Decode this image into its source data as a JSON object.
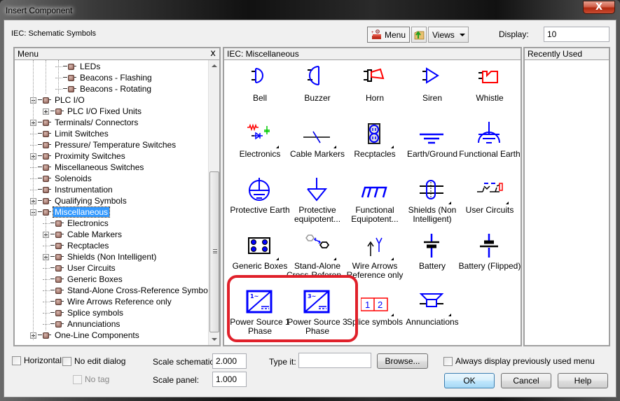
{
  "window": {
    "title": "Insert Component",
    "close_label": "X"
  },
  "header": {
    "library_label": "IEC: Schematic Symbols",
    "menu_button": "Menu",
    "views_button": "Views",
    "display_label": "Display:",
    "display_value": "10"
  },
  "menu_panel": {
    "title": "Menu",
    "close_label": "x",
    "items": [
      {
        "label": "LEDs",
        "level": 3,
        "expander": "none"
      },
      {
        "label": "Beacons - Flashing",
        "level": 3,
        "expander": "none"
      },
      {
        "label": "Beacons - Rotating",
        "level": 3,
        "expander": "none"
      },
      {
        "label": "PLC I/O",
        "level": 1,
        "expander": "minus"
      },
      {
        "label": "PLC I/O Fixed Units",
        "level": 2,
        "expander": "plus"
      },
      {
        "label": "Terminals/ Connectors",
        "level": 1,
        "expander": "plus"
      },
      {
        "label": "Limit Switches",
        "level": 1,
        "expander": "none"
      },
      {
        "label": "Pressure/ Temperature Switches",
        "level": 1,
        "expander": "none"
      },
      {
        "label": "Proximity Switches",
        "level": 1,
        "expander": "plus"
      },
      {
        "label": "Miscellaneous Switches",
        "level": 1,
        "expander": "none"
      },
      {
        "label": "Solenoids",
        "level": 1,
        "expander": "none"
      },
      {
        "label": "Instrumentation",
        "level": 1,
        "expander": "none"
      },
      {
        "label": "Qualifying Symbols",
        "level": 1,
        "expander": "plus"
      },
      {
        "label": "Miscellaneous",
        "level": 1,
        "expander": "minus",
        "selected": true
      },
      {
        "label": "Electronics",
        "level": 2,
        "expander": "none"
      },
      {
        "label": "Cable Markers",
        "level": 2,
        "expander": "plus"
      },
      {
        "label": "Recptacles",
        "level": 2,
        "expander": "none"
      },
      {
        "label": "Shields (Non Intelligent)",
        "level": 2,
        "expander": "plus"
      },
      {
        "label": "User Circuits",
        "level": 2,
        "expander": "none"
      },
      {
        "label": "Generic Boxes",
        "level": 2,
        "expander": "none"
      },
      {
        "label": "Stand-Alone Cross-Reference Symbols",
        "level": 2,
        "expander": "none"
      },
      {
        "label": "Wire Arrows Reference only",
        "level": 2,
        "expander": "none"
      },
      {
        "label": "Splice symbols",
        "level": 2,
        "expander": "none"
      },
      {
        "label": "Annunciations",
        "level": 2,
        "expander": "none"
      },
      {
        "label": "One-Line Components",
        "level": 1,
        "expander": "plus"
      }
    ]
  },
  "symbols_panel": {
    "title": "IEC: Miscellaneous",
    "symbols": [
      {
        "label": "Bell",
        "icon": "bell-icon",
        "submenu": false
      },
      {
        "label": "Buzzer",
        "icon": "buzzer-icon",
        "submenu": false
      },
      {
        "label": "Horn",
        "icon": "horn-icon",
        "submenu": false
      },
      {
        "label": "Siren",
        "icon": "siren-icon",
        "submenu": false
      },
      {
        "label": "Whistle",
        "icon": "whistle-icon",
        "submenu": false
      },
      {
        "label": "Electronics",
        "icon": "electronics-icon",
        "submenu": true
      },
      {
        "label": "Cable Markers",
        "icon": "cable-marker-icon",
        "submenu": true
      },
      {
        "label": "Recptacles",
        "icon": "receptacle-icon",
        "submenu": true
      },
      {
        "label": "Earth/Ground",
        "icon": "earth-ground-icon",
        "submenu": false
      },
      {
        "label": "Functional Earth",
        "icon": "functional-earth-icon",
        "submenu": false
      },
      {
        "label": "Protective Earth",
        "icon": "protective-earth-icon",
        "submenu": false
      },
      {
        "label": "Protective equipotent...",
        "icon": "protective-equipotential-icon",
        "submenu": false
      },
      {
        "label": "Functional Equipotent...",
        "icon": "functional-equipotential-icon",
        "submenu": false
      },
      {
        "label": "Shields (Non Intelligent)",
        "icon": "shield-icon",
        "submenu": true
      },
      {
        "label": "User Circuits",
        "icon": "user-circuit-icon",
        "submenu": true
      },
      {
        "label": "Generic Boxes",
        "icon": "generic-box-icon",
        "submenu": true
      },
      {
        "label": "Stand-Alone Cross-Referen...",
        "icon": "cross-reference-icon",
        "submenu": true
      },
      {
        "label": "Wire Arrows Reference only",
        "icon": "wire-arrow-icon",
        "submenu": true
      },
      {
        "label": "Battery",
        "icon": "battery-icon",
        "submenu": false
      },
      {
        "label": "Battery (Flipped)",
        "icon": "battery-flipped-icon",
        "submenu": false
      },
      {
        "label": "Power Source 1 Phase",
        "icon": "power-source-1-phase-icon",
        "submenu": false
      },
      {
        "label": "Power Source 3 Phase",
        "icon": "power-source-3-phase-icon",
        "submenu": false
      },
      {
        "label": "Splice symbols",
        "icon": "splice-icon",
        "submenu": true
      },
      {
        "label": "Annunciations",
        "icon": "annunciation-icon",
        "submenu": true
      }
    ]
  },
  "recent_panel": {
    "title": "Recently Used"
  },
  "footer": {
    "horizontal": "Horizontal",
    "no_edit_dialog": "No edit dialog",
    "no_tag": "No tag",
    "scale_schematic_label": "Scale schematic:",
    "scale_schematic_value": "2.000",
    "scale_panel_label": "Scale panel:",
    "scale_panel_value": "1.000",
    "type_it_label": "Type it:",
    "type_it_value": "",
    "browse": "Browse...",
    "always_display": "Always display previously used menu",
    "ok": "OK",
    "cancel": "Cancel",
    "help": "Help"
  },
  "colors": {
    "accent_blue": "#0000ff",
    "symbol_red": "#ff0000",
    "highlight_red": "#e0202a",
    "selection": "#3399ff"
  }
}
